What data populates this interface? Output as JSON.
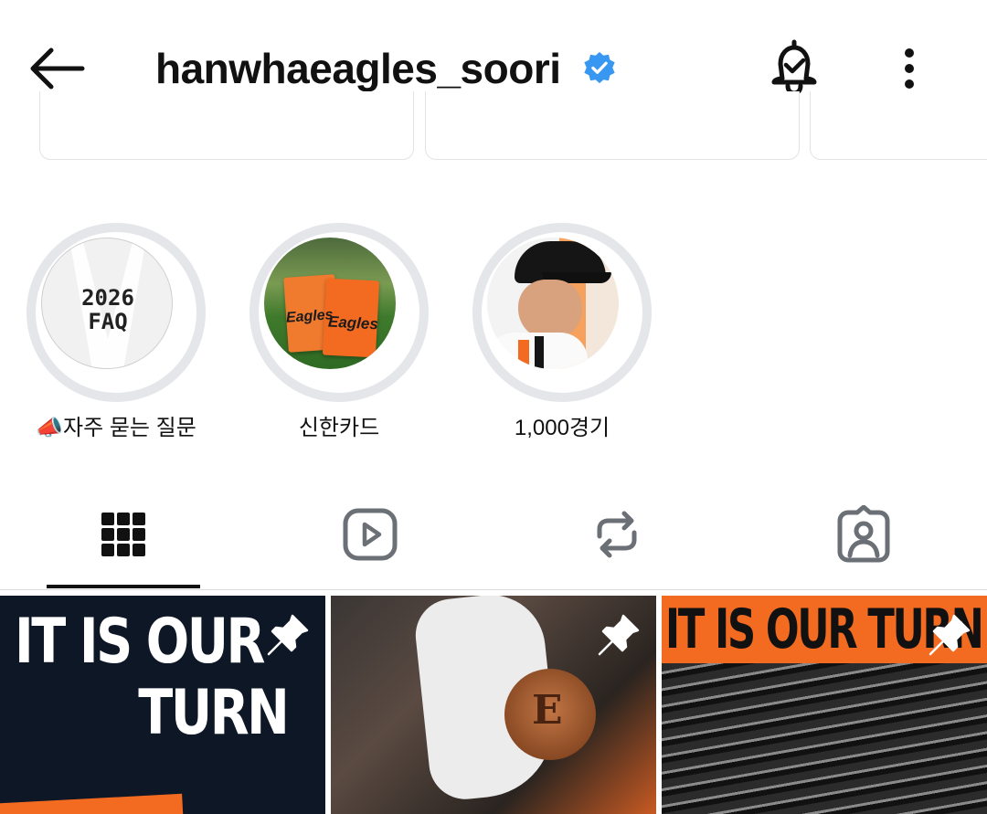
{
  "header": {
    "username": "hanwhaeagles_soori",
    "icons": {
      "back": "back-arrow-icon",
      "verified": "verified-badge-icon",
      "notifications": "bell-check-icon",
      "more": "more-vertical-icon"
    },
    "verified_color": "#3897f0"
  },
  "highlights": [
    {
      "label": "📣자주 묻는 질문",
      "cover_text_line1": "2026",
      "cover_text_line2": "FAQ"
    },
    {
      "label": "신한카드",
      "card_text": "Eagles"
    },
    {
      "label": "1,000경기"
    }
  ],
  "tabs": [
    {
      "icon": "grid-icon",
      "selected": true
    },
    {
      "icon": "reels-icon",
      "selected": false
    },
    {
      "icon": "reposts-icon",
      "selected": false
    },
    {
      "icon": "tagged-icon",
      "selected": false
    }
  ],
  "posts": [
    {
      "line1": "IT IS OUR",
      "line2": "TURN",
      "pinned": true
    },
    {
      "pinned": true
    },
    {
      "headline": "IT IS OUR TURN",
      "pinned": true
    }
  ],
  "colors": {
    "accent_orange": "#f26b21",
    "navy": "#0d1726"
  }
}
